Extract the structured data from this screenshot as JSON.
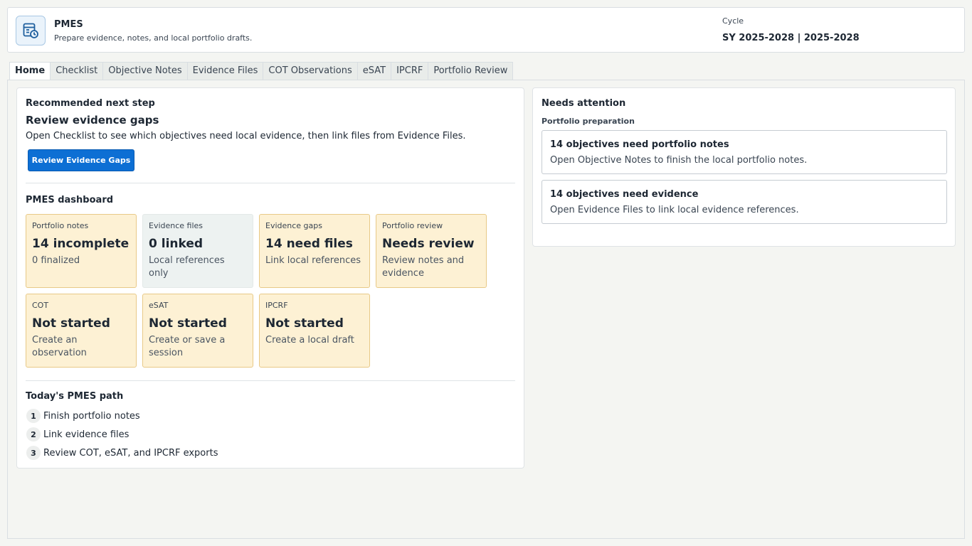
{
  "app": {
    "title": "PMES",
    "subtitle": "Prepare evidence, notes, and local portfolio drafts.",
    "icon": "dashboard-clock-icon",
    "accent_color": "#0d6fd4"
  },
  "cycle": {
    "label": "Cycle",
    "value": "SY 2025-2028 | 2025-2028"
  },
  "tabs": [
    {
      "label": "Home",
      "active": true
    },
    {
      "label": "Checklist"
    },
    {
      "label": "Objective Notes"
    },
    {
      "label": "Evidence Files"
    },
    {
      "label": "COT Observations"
    },
    {
      "label": "eSAT"
    },
    {
      "label": "IPCRF"
    },
    {
      "label": "Portfolio Review"
    }
  ],
  "next_step": {
    "heading": "Recommended next step",
    "title": "Review evidence gaps",
    "description": "Open Checklist to see which objectives need local evidence, then link files from Evidence Files.",
    "button_label": "Review Evidence Gaps"
  },
  "dashboard": {
    "heading": "PMES dashboard",
    "cards": [
      {
        "label": "Portfolio notes",
        "value": "14 incomplete",
        "sub": "0 finalized",
        "status": "warning"
      },
      {
        "label": "Evidence files",
        "value": "0 linked",
        "sub": "Local references only",
        "status": "neutral"
      },
      {
        "label": "Evidence gaps",
        "value": "14 need files",
        "sub": "Link local references",
        "status": "warning"
      },
      {
        "label": "Portfolio review",
        "value": "Needs review",
        "sub": "Review notes and evidence",
        "status": "warning"
      },
      {
        "label": "COT",
        "value": "Not started",
        "sub": "Create an observation",
        "status": "warning"
      },
      {
        "label": "eSAT",
        "value": "Not started",
        "sub": "Create or save a session",
        "status": "warning"
      },
      {
        "label": "IPCRF",
        "value": "Not started",
        "sub": "Create a local draft",
        "status": "warning"
      }
    ]
  },
  "path": {
    "heading": "Today's PMES path",
    "steps": [
      {
        "num": "1",
        "text": "Finish portfolio notes"
      },
      {
        "num": "2",
        "text": "Link evidence files"
      },
      {
        "num": "3",
        "text": "Review COT, eSAT, and IPCRF exports"
      }
    ]
  },
  "attention": {
    "heading": "Needs attention",
    "group_label": "Portfolio preparation",
    "items": [
      {
        "title": "14 objectives need portfolio notes",
        "desc": "Open Objective Notes to finish the local portfolio notes."
      },
      {
        "title": "14 objectives need evidence",
        "desc": "Open Evidence Files to link local evidence references."
      }
    ]
  },
  "colors": {
    "warning_bg": "#fdf1d4",
    "warning_border": "#e8c987",
    "neutral_bg": "#edf2f1"
  }
}
